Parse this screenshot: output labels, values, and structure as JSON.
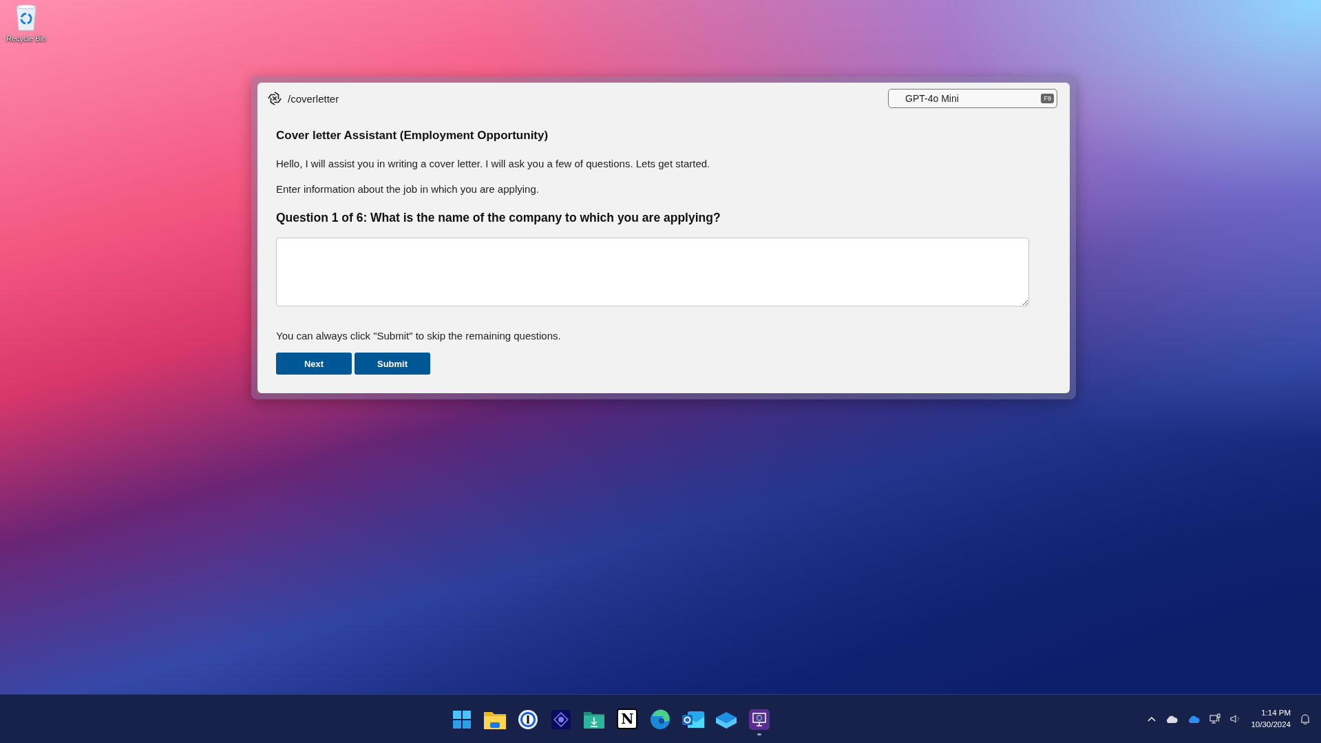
{
  "desktop": {
    "icons": [
      {
        "kind": "recycle-bin",
        "label": "Recycle Bin"
      }
    ]
  },
  "window": {
    "command": "/coverletter",
    "model": {
      "label": "GPT-4o Mini",
      "shortcut": "F9"
    },
    "heading": "Cover letter Assistant (Employment Opportunity)",
    "intro": [
      "Hello, I will assist you in writing a cover letter. I will ask you a few of questions. Lets get started.",
      "Enter information about the job in which you are applying."
    ],
    "question": "Question 1 of 6: What is the name of the company to which you are applying?",
    "note": "You can always click \"Submit\" to skip the remaining questions.",
    "buttons": [
      "Next",
      "Submit"
    ]
  },
  "taskbar": {
    "apps": [
      {
        "kind": "start",
        "running": false
      },
      {
        "kind": "folder",
        "running": false
      },
      {
        "kind": "password",
        "running": false
      },
      {
        "kind": "video",
        "running": false
      },
      {
        "kind": "downloads",
        "running": false
      },
      {
        "kind": "notes",
        "glyph": "N",
        "running": false
      },
      {
        "kind": "browser",
        "running": false
      },
      {
        "kind": "mail",
        "running": false
      },
      {
        "kind": "box",
        "running": false
      },
      {
        "kind": "monitor",
        "running": true
      }
    ],
    "tray": {
      "time": "1:14 PM",
      "date": "10/30/2024"
    }
  }
}
